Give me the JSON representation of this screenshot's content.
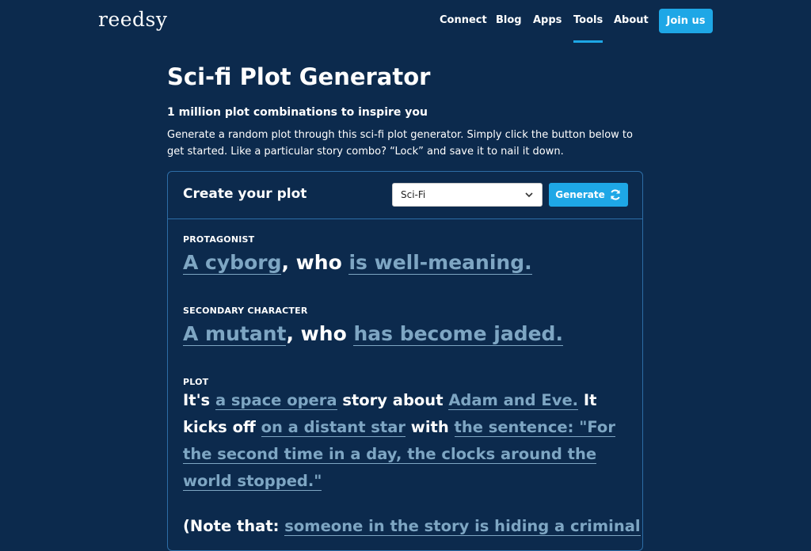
{
  "header": {
    "logo": "reedsy",
    "nav": [
      "Connect",
      "Blog",
      "Apps",
      "Tools",
      "About"
    ],
    "active_nav": "Tools",
    "join_label": "Join us"
  },
  "intro": {
    "title": "Sci-fi Plot Generator",
    "subtitle": "1 million plot combinations to inspire you",
    "description": "Generate a random plot through this sci-fi plot generator. Simply click the button below to get started. Like a particular story combo? “Lock” and save it to nail it down."
  },
  "card": {
    "title": "Create your plot",
    "genre_selected": "Sci-Fi",
    "generate_label": "Generate",
    "protagonist": {
      "label": "PROTAGONIST",
      "who": "A cyborg",
      "connector": ", who ",
      "trait": "is well-meaning."
    },
    "secondary": {
      "label": "SECONDARY CHARACTER",
      "who": "A mutant",
      "connector": ", who ",
      "trait": "has become jaded."
    },
    "plot": {
      "label": "PLOT",
      "t1": "It's ",
      "genre": "a space opera",
      "t2": " story about ",
      "subject": "Adam and Eve.",
      "t3": " It kicks off ",
      "setting": "on a distant star",
      "t4": " with ",
      "opening": "the sentence: \"For the second time in a day, the clocks around the world stopped.\""
    },
    "note": {
      "t1": "(Note that: ",
      "twist": "someone in the story is hiding a criminal"
    }
  },
  "colors": {
    "background": "#0c2a4d",
    "accent": "#1ea7e6",
    "pick": "#7ea6c3",
    "border": "#2d6da6"
  },
  "icons": [
    "chevron-down-icon",
    "refresh-icon"
  ]
}
